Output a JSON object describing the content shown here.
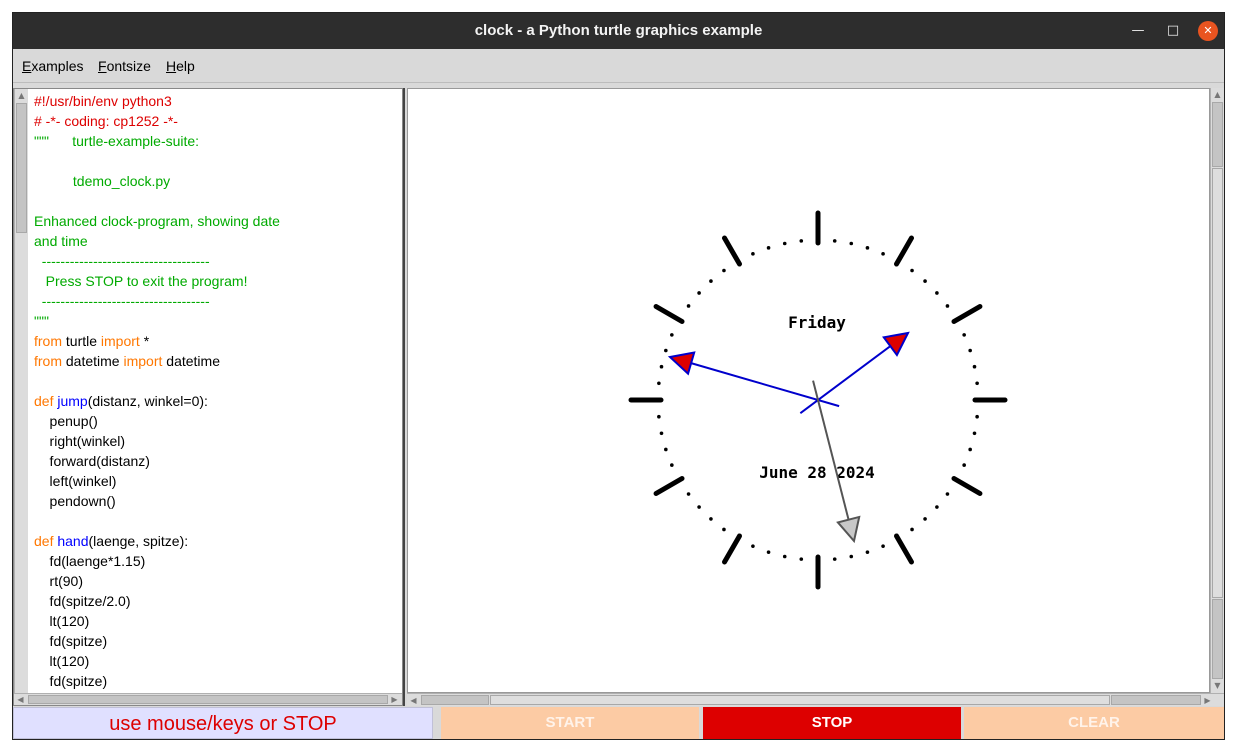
{
  "window": {
    "title": "clock - a Python turtle graphics example"
  },
  "menu": [
    "Examples",
    "Fontsize",
    "Help"
  ],
  "code_lines": [
    [
      {
        "t": "#!/usr/bin/env python3",
        "c": "red"
      }
    ],
    [
      {
        "t": "# -*- coding: cp1252 -*-",
        "c": "red"
      }
    ],
    [
      {
        "t": "\"\"\"      turtle-example-suite:",
        "c": "green"
      }
    ],
    [],
    [
      {
        "t": "          tdemo_clock.py",
        "c": "green"
      }
    ],
    [],
    [
      {
        "t": "Enhanced clock-program, showing date",
        "c": "green"
      }
    ],
    [
      {
        "t": "and time",
        "c": "green"
      }
    ],
    [
      {
        "t": "  ------------------------------------",
        "c": "green"
      }
    ],
    [
      {
        "t": "   Press STOP to exit the program!",
        "c": "green"
      }
    ],
    [
      {
        "t": "  ------------------------------------",
        "c": "green"
      }
    ],
    [
      {
        "t": "\"\"\"",
        "c": "green"
      }
    ],
    [
      {
        "t": "from",
        "c": "orange"
      },
      {
        "t": " turtle "
      },
      {
        "t": "import",
        "c": "orange"
      },
      {
        "t": " *"
      }
    ],
    [
      {
        "t": "from",
        "c": "orange"
      },
      {
        "t": " datetime "
      },
      {
        "t": "import",
        "c": "orange"
      },
      {
        "t": " datetime"
      }
    ],
    [],
    [
      {
        "t": "def",
        "c": "orange"
      },
      {
        "t": " "
      },
      {
        "t": "jump",
        "c": "blue"
      },
      {
        "t": "(distanz, winkel=0):"
      }
    ],
    [
      {
        "t": "    penup()"
      }
    ],
    [
      {
        "t": "    right(winkel)"
      }
    ],
    [
      {
        "t": "    forward(distanz)"
      }
    ],
    [
      {
        "t": "    left(winkel)"
      }
    ],
    [
      {
        "t": "    pendown()"
      }
    ],
    [],
    [
      {
        "t": "def",
        "c": "orange"
      },
      {
        "t": " "
      },
      {
        "t": "hand",
        "c": "blue"
      },
      {
        "t": "(laenge, spitze):"
      }
    ],
    [
      {
        "t": "    fd(laenge*1.15)"
      }
    ],
    [
      {
        "t": "    rt(90)"
      }
    ],
    [
      {
        "t": "    fd(spitze/2.0)"
      }
    ],
    [
      {
        "t": "    lt(120)"
      }
    ],
    [
      {
        "t": "    fd(spitze)"
      }
    ],
    [
      {
        "t": "    lt(120)"
      }
    ],
    [
      {
        "t": "    fd(spitze)"
      }
    ]
  ],
  "clock": {
    "weekday": "Friday",
    "date": "June 28 2024",
    "hour_hand_color": "#0000cc",
    "hour_hand_tip": "#dd0000",
    "minute_hand_color": "#0000cc",
    "second_hand_color": "#555555",
    "second_hand_tip": "#c8c8c8"
  },
  "status": {
    "text": "use mouse/keys or STOP"
  },
  "buttons": {
    "start": "START",
    "stop": "STOP",
    "clear": "CLEAR"
  },
  "colors": {
    "stop_active": "#dd0000",
    "inactive_button": "#fccba4",
    "status_bg": "#e0e0ff"
  }
}
